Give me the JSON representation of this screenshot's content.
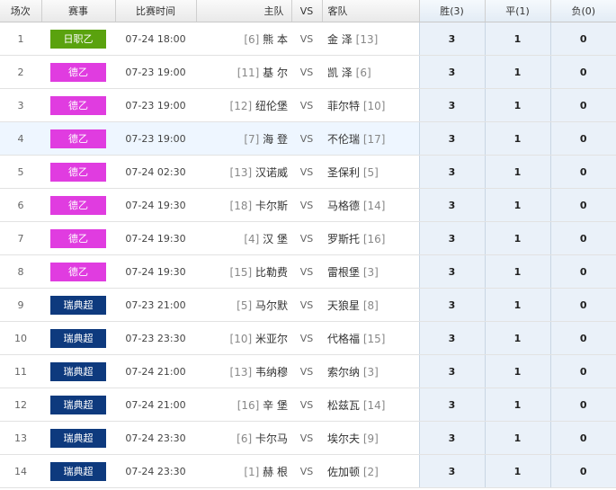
{
  "headers": {
    "no": "场次",
    "league": "赛事",
    "time": "比赛时间",
    "home": "主队",
    "vs": "VS",
    "away": "客队",
    "win": "胜(3)",
    "draw": "平(1)",
    "lose": "负(0)"
  },
  "rows": [
    {
      "no": "1",
      "league": "日职乙",
      "league_color": "#5aa20e",
      "time": "07-24 18:00",
      "home_rank": "[6]",
      "home": "熊 本",
      "vs": "VS",
      "away": "金 泽",
      "away_rank": "[13]",
      "win": "3",
      "draw": "1",
      "lose": "0"
    },
    {
      "no": "2",
      "league": "德乙",
      "league_color": "#e03ce0",
      "time": "07-23 19:00",
      "home_rank": "[11]",
      "home": "基 尔",
      "vs": "VS",
      "away": "凯 泽",
      "away_rank": "[6]",
      "win": "3",
      "draw": "1",
      "lose": "0"
    },
    {
      "no": "3",
      "league": "德乙",
      "league_color": "#e03ce0",
      "time": "07-23 19:00",
      "home_rank": "[12]",
      "home": "纽伦堡",
      "vs": "VS",
      "away": "菲尔特",
      "away_rank": "[10]",
      "win": "3",
      "draw": "1",
      "lose": "0"
    },
    {
      "no": "4",
      "league": "德乙",
      "league_color": "#e03ce0",
      "time": "07-23 19:00",
      "home_rank": "[7]",
      "home": "海 登",
      "vs": "VS",
      "away": "不伦瑞",
      "away_rank": "[17]",
      "win": "3",
      "draw": "1",
      "lose": "0"
    },
    {
      "no": "5",
      "league": "德乙",
      "league_color": "#e03ce0",
      "time": "07-24 02:30",
      "home_rank": "[13]",
      "home": "汉诺威",
      "vs": "VS",
      "away": "圣保利",
      "away_rank": "[5]",
      "win": "3",
      "draw": "1",
      "lose": "0"
    },
    {
      "no": "6",
      "league": "德乙",
      "league_color": "#e03ce0",
      "time": "07-24 19:30",
      "home_rank": "[18]",
      "home": "卡尔斯",
      "vs": "VS",
      "away": "马格德",
      "away_rank": "[14]",
      "win": "3",
      "draw": "1",
      "lose": "0"
    },
    {
      "no": "7",
      "league": "德乙",
      "league_color": "#e03ce0",
      "time": "07-24 19:30",
      "home_rank": "[4]",
      "home": "汉 堡",
      "vs": "VS",
      "away": "罗斯托",
      "away_rank": "[16]",
      "win": "3",
      "draw": "1",
      "lose": "0"
    },
    {
      "no": "8",
      "league": "德乙",
      "league_color": "#e03ce0",
      "time": "07-24 19:30",
      "home_rank": "[15]",
      "home": "比勒费",
      "vs": "VS",
      "away": "雷根堡",
      "away_rank": "[3]",
      "win": "3",
      "draw": "1",
      "lose": "0"
    },
    {
      "no": "9",
      "league": "瑞典超",
      "league_color": "#0e3a7e",
      "time": "07-23 21:00",
      "home_rank": "[5]",
      "home": "马尔默",
      "vs": "VS",
      "away": "天狼星",
      "away_rank": "[8]",
      "win": "3",
      "draw": "1",
      "lose": "0"
    },
    {
      "no": "10",
      "league": "瑞典超",
      "league_color": "#0e3a7e",
      "time": "07-23 23:30",
      "home_rank": "[10]",
      "home": "米亚尔",
      "vs": "VS",
      "away": "代格福",
      "away_rank": "[15]",
      "win": "3",
      "draw": "1",
      "lose": "0"
    },
    {
      "no": "11",
      "league": "瑞典超",
      "league_color": "#0e3a7e",
      "time": "07-24 21:00",
      "home_rank": "[13]",
      "home": "韦纳穆",
      "vs": "VS",
      "away": "索尔纳",
      "away_rank": "[3]",
      "win": "3",
      "draw": "1",
      "lose": "0"
    },
    {
      "no": "12",
      "league": "瑞典超",
      "league_color": "#0e3a7e",
      "time": "07-24 21:00",
      "home_rank": "[16]",
      "home": "辛 堡",
      "vs": "VS",
      "away": "松兹瓦",
      "away_rank": "[14]",
      "win": "3",
      "draw": "1",
      "lose": "0"
    },
    {
      "no": "13",
      "league": "瑞典超",
      "league_color": "#0e3a7e",
      "time": "07-24 23:30",
      "home_rank": "[6]",
      "home": "卡尔马",
      "vs": "VS",
      "away": "埃尔夫",
      "away_rank": "[9]",
      "win": "3",
      "draw": "1",
      "lose": "0"
    },
    {
      "no": "14",
      "league": "瑞典超",
      "league_color": "#0e3a7e",
      "time": "07-24 23:30",
      "home_rank": "[1]",
      "home": "赫 根",
      "vs": "VS",
      "away": "佐加顿",
      "away_rank": "[2]",
      "win": "3",
      "draw": "1",
      "lose": "0"
    }
  ],
  "highlight_row": "4"
}
